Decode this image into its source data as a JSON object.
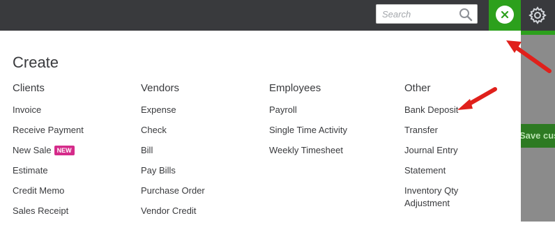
{
  "header": {
    "search": {
      "placeholder": "Search"
    },
    "create_close_icon": "close-icon",
    "settings_icon": "gear-icon"
  },
  "background": {
    "save_button_label": "Save cus"
  },
  "create_menu": {
    "title": "Create",
    "columns": [
      {
        "header": "Clients",
        "items": [
          {
            "label": "Invoice"
          },
          {
            "label": "Receive Payment"
          },
          {
            "label": "New Sale",
            "badge": "NEW"
          },
          {
            "label": "Estimate"
          },
          {
            "label": "Credit Memo"
          },
          {
            "label": "Sales Receipt"
          }
        ]
      },
      {
        "header": "Vendors",
        "items": [
          {
            "label": "Expense"
          },
          {
            "label": "Check"
          },
          {
            "label": "Bill"
          },
          {
            "label": "Pay Bills"
          },
          {
            "label": "Purchase Order"
          },
          {
            "label": "Vendor Credit"
          }
        ]
      },
      {
        "header": "Employees",
        "items": [
          {
            "label": "Payroll"
          },
          {
            "label": "Single Time Activity"
          },
          {
            "label": "Weekly Timesheet"
          }
        ]
      },
      {
        "header": "Other",
        "items": [
          {
            "label": "Bank Deposit"
          },
          {
            "label": "Transfer"
          },
          {
            "label": "Journal Entry"
          },
          {
            "label": "Statement"
          },
          {
            "label": "Inventory Qty Adjustment"
          }
        ]
      }
    ]
  },
  "colors": {
    "topbar": "#393a3d",
    "accent_green": "#2ca01c",
    "badge_pink": "#d52b8a",
    "annotation_red": "#e0201b"
  }
}
